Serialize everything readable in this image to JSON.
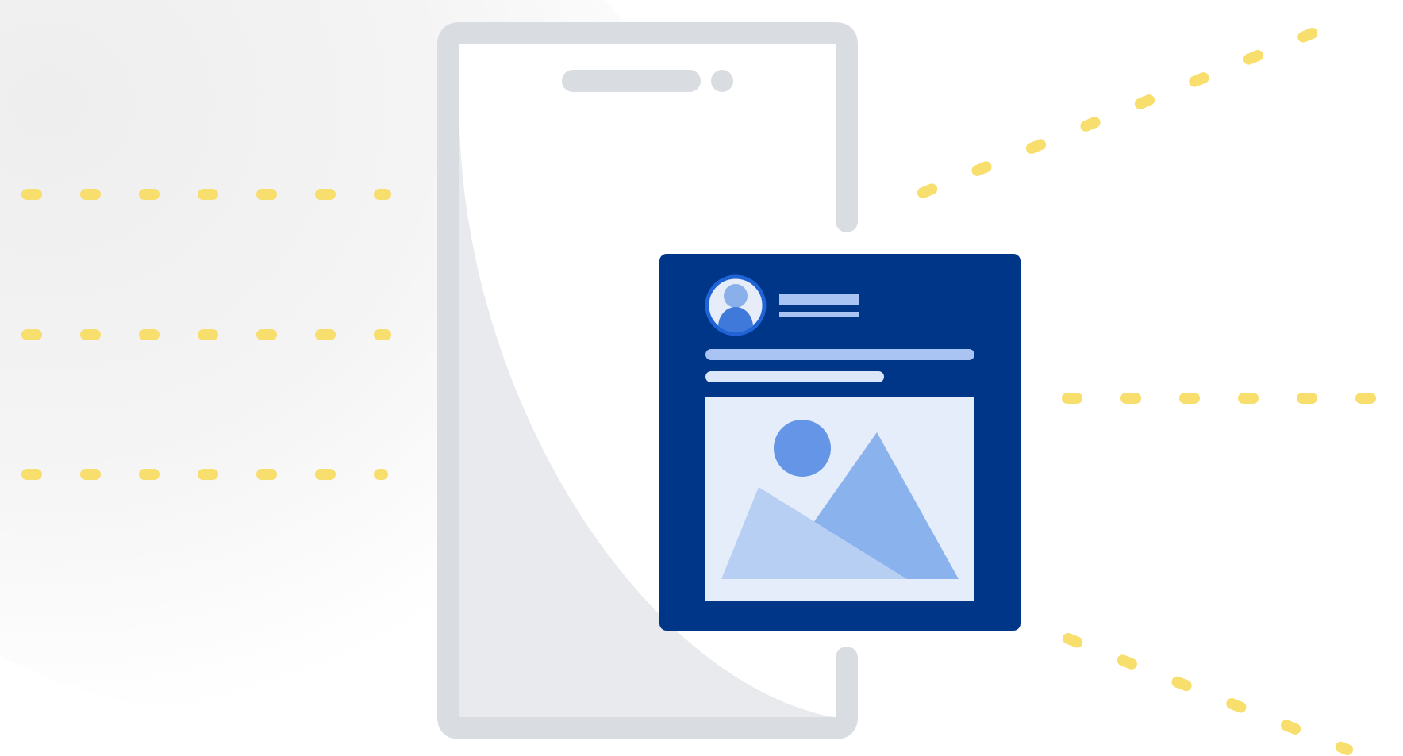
{
  "illustration": {
    "subject": "smartphone",
    "card_content": [
      "avatar-icon",
      "image-placeholder-icon"
    ],
    "colors": {
      "background": "#ffffff",
      "phone_frame": "#d9dce0",
      "phone_screen": "#ffffff",
      "phone_screen_shade": "#e9eaed",
      "card": "#003687",
      "card_lines": "#a9c4f2",
      "avatar_ring": "#1f63d6",
      "avatar_fill": "#e6ecf8",
      "avatar_head": "#8ab0ec",
      "avatar_body": "#3f79d9",
      "image_bg": "#e5ecfa",
      "image_sun": "#6495e6",
      "image_mountain_back": "#8ab2ec",
      "image_mountain_front": "#b8cff4",
      "dashes": "#f7de6d"
    }
  }
}
